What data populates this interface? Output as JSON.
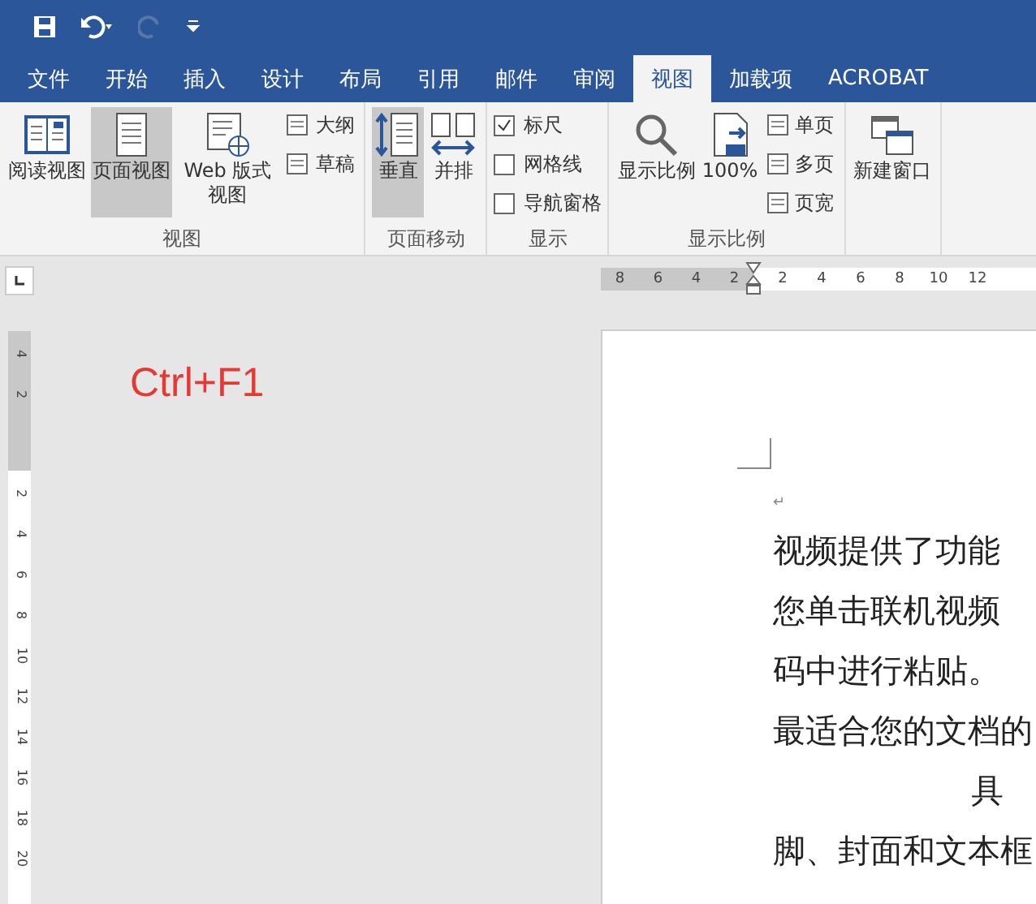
{
  "quick_access": {
    "items": [
      {
        "kind": "save",
        "disabled": false
      },
      {
        "kind": "undo",
        "disabled": false
      },
      {
        "kind": "redo",
        "disabled": true
      },
      {
        "kind": "customize",
        "disabled": false
      }
    ]
  },
  "tabs": [
    {
      "label": "文件",
      "selected": false
    },
    {
      "label": "开始",
      "selected": false
    },
    {
      "label": "插入",
      "selected": false
    },
    {
      "label": "设计",
      "selected": false
    },
    {
      "label": "布局",
      "selected": false
    },
    {
      "label": "引用",
      "selected": false
    },
    {
      "label": "邮件",
      "selected": false
    },
    {
      "label": "审阅",
      "selected": false
    },
    {
      "label": "视图",
      "selected": true
    },
    {
      "label": "加载项",
      "selected": false
    },
    {
      "label": "ACROBAT",
      "selected": false
    }
  ],
  "ribbon": {
    "groups": [
      {
        "label": "视图",
        "items": [
          {
            "kind": "large",
            "label": "阅读视图",
            "selected": false
          },
          {
            "kind": "large",
            "label": "页面视图",
            "selected": true
          },
          {
            "kind": "large",
            "label": "Web 版式视图",
            "selected": false
          },
          {
            "kind": "small",
            "label": "大纲",
            "selected": false
          },
          {
            "kind": "small",
            "label": "草稿",
            "selected": false
          }
        ]
      },
      {
        "label": "页面移动",
        "items": [
          {
            "kind": "large",
            "label": "垂直",
            "selected": true
          },
          {
            "kind": "large",
            "label": "并排",
            "selected": false
          }
        ]
      },
      {
        "label": "显示",
        "items": [
          {
            "kind": "check",
            "label": "标尺",
            "checked": true
          },
          {
            "kind": "check",
            "label": "网格线",
            "checked": false
          },
          {
            "kind": "check",
            "label": "导航窗格",
            "checked": false
          }
        ]
      },
      {
        "label": "显示比例",
        "items": [
          {
            "kind": "large",
            "label": "显示比例",
            "selected": false
          },
          {
            "kind": "large",
            "label": "100%",
            "selected": false
          },
          {
            "kind": "small",
            "label": "单页",
            "selected": false
          },
          {
            "kind": "small",
            "label": "多页",
            "selected": false
          },
          {
            "kind": "small",
            "label": "页宽",
            "selected": false
          }
        ]
      },
      {
        "items": [
          {
            "kind": "large",
            "label": "新建窗口",
            "selected": false
          }
        ]
      }
    ]
  },
  "ruler": {
    "gray_marks": [
      "8",
      "6",
      "4",
      "2"
    ],
    "white_marks": [
      "2",
      "4",
      "6",
      "8",
      "10",
      "12"
    ]
  },
  "vertical_ruler": {
    "gray_marks": [
      "4",
      "2"
    ],
    "white_marks": [
      "2",
      "4",
      "6",
      "8",
      "10",
      "12",
      "14",
      "16",
      "18",
      "20"
    ]
  },
  "annotation": "Ctrl+F1",
  "document": {
    "paragraph_mark": "↵",
    "lines": [
      {
        "text": "视频提供了功能",
        "kind": "full"
      },
      {
        "text": "您单击联机视频",
        "kind": "full"
      },
      {
        "text": "码中进行粘贴。",
        "kind": "full"
      },
      {
        "text": "最适合您的文档的",
        "kind": "full"
      },
      {
        "text": "具",
        "kind": "tail"
      },
      {
        "text": "脚、封面和文本框",
        "kind": "full"
      }
    ]
  }
}
